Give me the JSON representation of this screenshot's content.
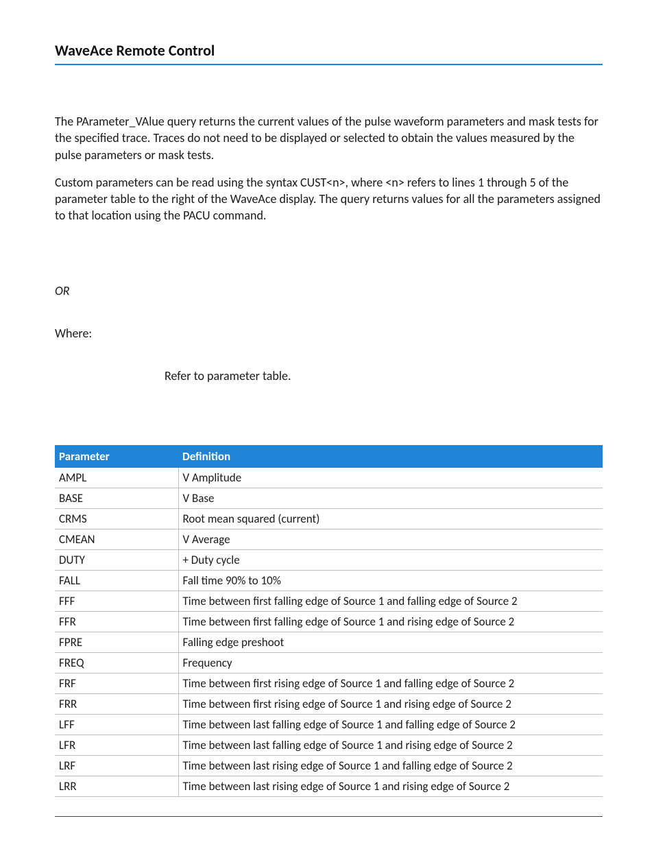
{
  "header": {
    "title": "WaveAce Remote Control"
  },
  "body": {
    "p1": "The PArameter_VAlue query returns the current values of the pulse waveform parameters and mask tests for the specified trace. Traces do not need to be displayed or selected to obtain the values measured by the pulse parameters or mask tests.",
    "p2": "Custom parameters can be read using the syntax CUST<n>, where <n> refers to lines 1 through 5 of the parameter table to the right of the WaveAce display. The query returns values for all the parameters assigned to that location using the PACU command.",
    "or": "OR",
    "where": "Where:",
    "refer": "Refer to parameter table."
  },
  "table": {
    "head": {
      "param": "Parameter",
      "def": "Definition"
    },
    "rows": [
      {
        "param": "AMPL",
        "def": "V Amplitude"
      },
      {
        "param": "BASE",
        "def": "V Base"
      },
      {
        "param": "CRMS",
        "def": "Root mean squared (current)"
      },
      {
        "param": "CMEAN",
        "def": "V Average"
      },
      {
        "param": "DUTY",
        "def": "+ Duty cycle"
      },
      {
        "param": "FALL",
        "def": "Fall time 90% to 10%"
      },
      {
        "param": "FFF",
        "def": "Time between first falling edge of Source 1 and falling edge  of  Source 2"
      },
      {
        "param": "FFR",
        "def": "Time between first falling edge of Source 1 and rising edge of Source 2"
      },
      {
        "param": "FPRE",
        "def": "Falling edge preshoot"
      },
      {
        "param": "FREQ",
        "def": "Frequency"
      },
      {
        "param": "FRF",
        "def": "Time between first rising edge of Source 1 and falling edge of Source 2"
      },
      {
        "param": "FRR",
        "def": "Time between first rising edge of Source 1 and rising edge of Source 2"
      },
      {
        "param": "LFF",
        "def": "Time between last falling edge of Source 1 and falling edge of Source 2"
      },
      {
        "param": "LFR",
        "def": "Time between last falling edge of Source 1 and rising edge of Source 2"
      },
      {
        "param": "LRF",
        "def": "Time between last rising edge of Source 1 and falling edge of Source 2"
      },
      {
        "param": "LRR",
        "def": "Time between last rising edge of Source 1 and rising edge of Source 2"
      }
    ]
  }
}
